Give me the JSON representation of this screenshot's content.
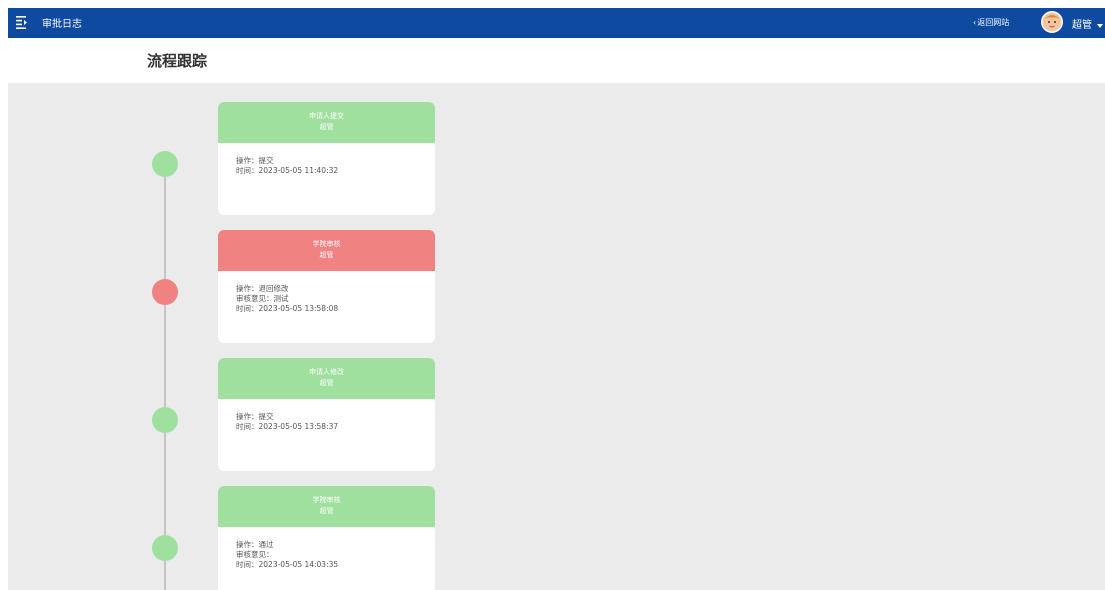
{
  "header": {
    "menu_icon": "menu-icon",
    "app_title": "审批日志",
    "back_link": "返回网站",
    "back_icon": "chevron-left-icon",
    "avatar_icon": "user-avatar-icon",
    "user_name": "超管",
    "dropdown_icon": "caret-down-icon",
    "bar_color": "#0f4aa1"
  },
  "page": {
    "title": "流程跟踪"
  },
  "colors": {
    "success": "#a0e09e",
    "reject": "#f08282",
    "timeline": "#c4c4c4",
    "background": "#ebebeb"
  },
  "timeline": {
    "items": [
      {
        "status": "success",
        "step": "申请人提交",
        "actor": "超管",
        "action": "操作：提交",
        "opinion": "",
        "time": "时间：2023-05-05 11:40:32"
      },
      {
        "status": "reject",
        "step": "学院审核",
        "actor": "超管",
        "action": "操作：退回修改",
        "opinion": "审核意见：测试",
        "time": "时间：2023-05-05 13:58:08"
      },
      {
        "status": "success",
        "step": "申请人修改",
        "actor": "超管",
        "action": "操作：提交",
        "opinion": "",
        "time": "时间：2023-05-05 13:58:37"
      },
      {
        "status": "success",
        "step": "学院审核",
        "actor": "超管",
        "action": "操作：通过",
        "opinion": "审核意见：",
        "time": "时间：2023-05-05 14:03:35"
      }
    ]
  }
}
